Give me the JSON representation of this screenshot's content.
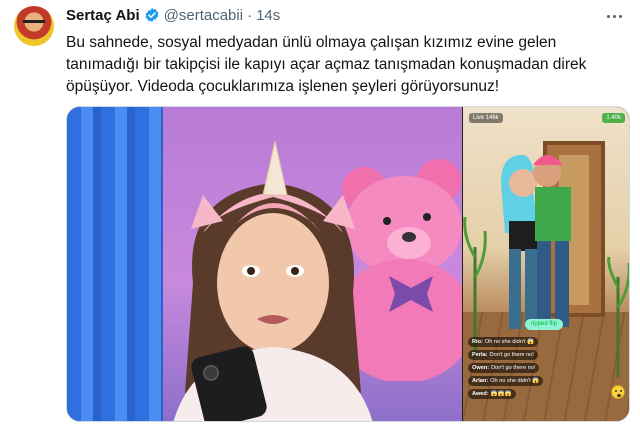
{
  "tweet": {
    "author_name": "Sertaç Abi",
    "handle": "@sertacabii",
    "separator": "·",
    "time": "14s",
    "text": "Bu sahnede, sosyal medyadan ünlü olmaya çalışan kızımız evine gelen tanımadığı bir takipçisi ile kapıyı açar açmaz tanışmadan konuşmadan direk öpüşüyor. Videoda çocuklarımıza işlenen şeyleri görüyorsunuz!",
    "verified_icon": "verified-badge-icon",
    "more_icon": "more-options-icon",
    "accent_color": "#1d9bf0"
  },
  "media": {
    "game_overlay": {
      "live_label": "Live 146k",
      "coins_label": "1.40k",
      "chip_label": "ripped flip",
      "chat": [
        {
          "user": "Rio:",
          "msg": "Oh no she didn't 😱"
        },
        {
          "user": "Perla:",
          "msg": "Don't go there no!"
        },
        {
          "user": "Owen:",
          "msg": "Don't go there no!"
        },
        {
          "user": "Arlan:",
          "msg": "Oh no she didn't 😱"
        },
        {
          "user": "Awed:",
          "msg": "😱😱😱"
        }
      ]
    }
  }
}
